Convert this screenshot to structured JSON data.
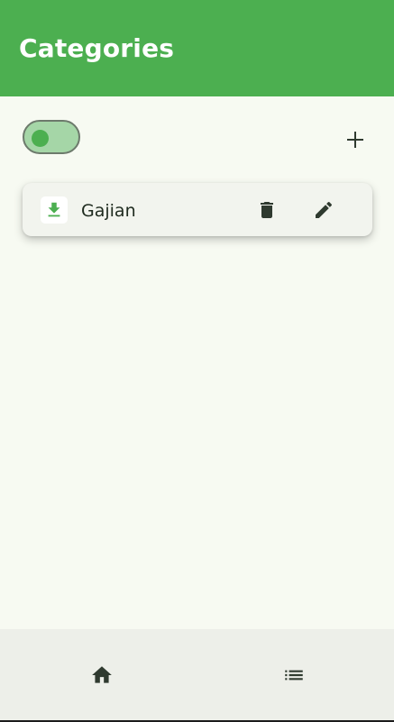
{
  "appbar": {
    "title": "Categories",
    "color": "#4caf50"
  },
  "controls": {
    "type_toggle": {
      "on": true,
      "icon": "toggle-switch"
    },
    "add_icon": "plus-icon"
  },
  "categories": [
    {
      "name": "Gajian",
      "icon": "download-icon",
      "icon_color": "#4caf50",
      "actions": [
        "delete-icon",
        "edit-icon"
      ]
    }
  ],
  "bottom_nav": {
    "items": [
      {
        "icon": "home-icon"
      },
      {
        "icon": "list-icon"
      }
    ]
  },
  "colors": {
    "background": "#f7faf2",
    "accent": "#4caf50",
    "icon_dark": "#2f3a2f"
  }
}
